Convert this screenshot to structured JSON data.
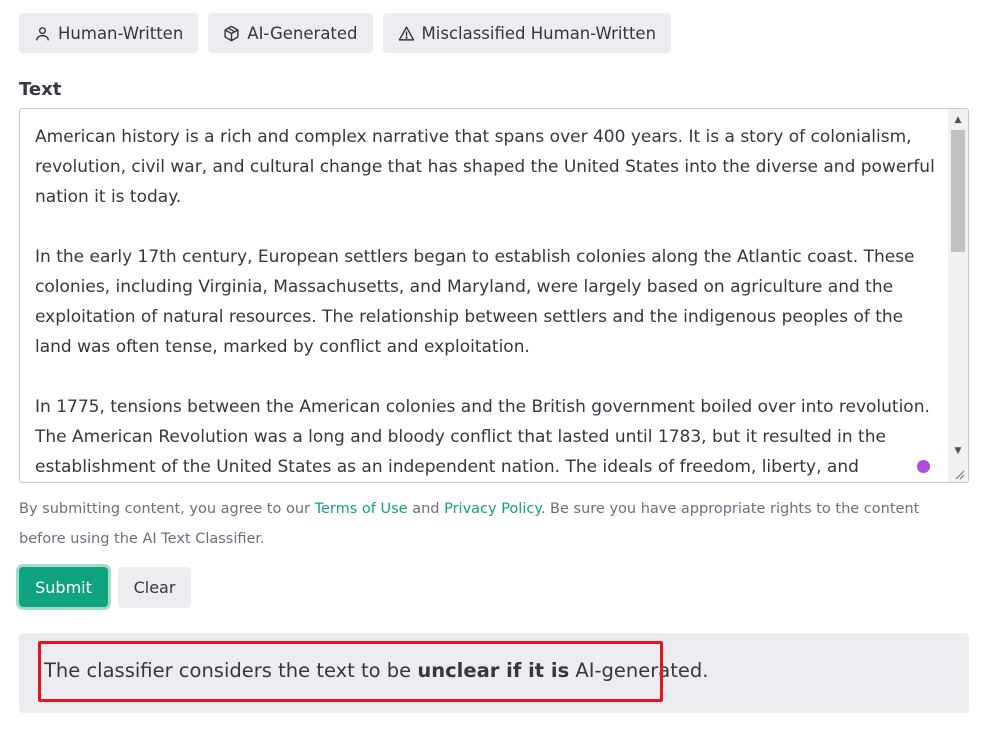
{
  "examples": {
    "human_written": {
      "label": "Human-Written",
      "icon": "person-icon"
    },
    "ai_generated": {
      "label": "AI-Generated",
      "icon": "cube-icon"
    },
    "misclassified": {
      "label": "Misclassified Human-Written",
      "icon": "warning-triangle-icon"
    }
  },
  "text_field": {
    "label": "Text",
    "paragraphs": [
      "American history is a rich and complex narrative that spans over 400 years. It is a story of colonialism, revolution, civil war, and cultural change that has shaped the United States into the diverse and powerful nation it is today.",
      "In the early 17th century, European settlers began to establish colonies along the Atlantic coast. These colonies, including Virginia, Massachusetts, and Maryland, were largely based on agriculture and the exploitation of natural resources. The relationship between settlers and the indigenous peoples of the land was often tense, marked by conflict and exploitation.",
      "In 1775, tensions between the American colonies and the British government boiled over into revolution. The American Revolution was a long and bloody conflict that lasted until 1783, but it resulted in the establishment of the United States as an independent nation. The ideals of freedom, liberty, and democracy"
    ]
  },
  "disclaimer": {
    "prefix": "By submitting content, you agree to our ",
    "terms_link": "Terms of Use",
    "middle": " and ",
    "privacy_link": "Privacy Policy",
    "suffix": ". Be sure you have appropriate rights to the content before using the AI Text Classifier."
  },
  "actions": {
    "submit_label": "Submit",
    "clear_label": "Clear"
  },
  "result": {
    "prefix": "The classifier considers the text to be ",
    "verdict": "unclear if it is",
    "suffix": " AI-generated."
  },
  "colors": {
    "accent": "#10a37f",
    "pill_background": "#ececf1",
    "highlight_border": "#e8141c",
    "grammar_dot": "#b04bdc"
  }
}
